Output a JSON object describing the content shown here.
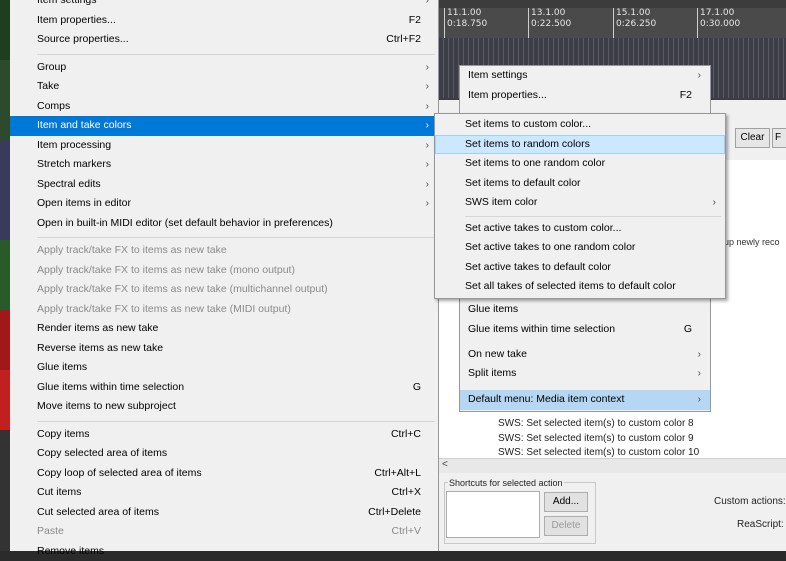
{
  "timeline": {
    "ticks": [
      {
        "bar": "11.1.00",
        "time": "0:18.750"
      },
      {
        "bar": "13.1.00",
        "time": "0:22.500"
      },
      {
        "bar": "15.1.00",
        "time": "0:26.250"
      },
      {
        "bar": "17.1.00",
        "time": "0:30.000"
      }
    ]
  },
  "main_menu": {
    "items": [
      {
        "label": "Item settings",
        "shortcut": "",
        "submenu": true,
        "disabled": false
      },
      {
        "label": "Item properties...",
        "shortcut": "F2",
        "submenu": false,
        "disabled": false
      },
      {
        "label": "Source properties...",
        "shortcut": "Ctrl+F2",
        "submenu": false,
        "disabled": false
      },
      {
        "sep": true
      },
      {
        "label": "Group",
        "shortcut": "",
        "submenu": true,
        "disabled": false
      },
      {
        "label": "Take",
        "shortcut": "",
        "submenu": true,
        "disabled": false
      },
      {
        "label": "Comps",
        "shortcut": "",
        "submenu": true,
        "disabled": false
      },
      {
        "label": "Item and take colors",
        "shortcut": "",
        "submenu": true,
        "disabled": false,
        "highlight": true
      },
      {
        "label": "Item processing",
        "shortcut": "",
        "submenu": true,
        "disabled": false
      },
      {
        "label": "Stretch markers",
        "shortcut": "",
        "submenu": true,
        "disabled": false
      },
      {
        "label": "Spectral edits",
        "shortcut": "",
        "submenu": true,
        "disabled": false
      },
      {
        "label": "Open items in editor",
        "shortcut": "",
        "submenu": true,
        "disabled": false
      },
      {
        "label": "Open in built-in MIDI editor (set default behavior in preferences)",
        "shortcut": "",
        "submenu": false,
        "disabled": false
      },
      {
        "sep": true
      },
      {
        "label": "Apply track/take FX to items as new take",
        "shortcut": "",
        "submenu": false,
        "disabled": true
      },
      {
        "label": "Apply track/take FX to items as new take (mono output)",
        "shortcut": "",
        "submenu": false,
        "disabled": true
      },
      {
        "label": "Apply track/take FX to items as new take (multichannel output)",
        "shortcut": "",
        "submenu": false,
        "disabled": true
      },
      {
        "label": "Apply track/take FX to items as new take (MIDI output)",
        "shortcut": "",
        "submenu": false,
        "disabled": true
      },
      {
        "label": "Render items as new take",
        "shortcut": "",
        "submenu": false,
        "disabled": false
      },
      {
        "label": "Reverse items as new take",
        "shortcut": "",
        "submenu": false,
        "disabled": false
      },
      {
        "label": "Glue items",
        "shortcut": "",
        "submenu": false,
        "disabled": false
      },
      {
        "label": "Glue items within time selection",
        "shortcut": "G",
        "submenu": false,
        "disabled": false
      },
      {
        "label": "Move items to new subproject",
        "shortcut": "",
        "submenu": false,
        "disabled": false
      },
      {
        "sep": true
      },
      {
        "label": "Copy items",
        "shortcut": "Ctrl+C",
        "submenu": false,
        "disabled": false
      },
      {
        "label": "Copy selected area of items",
        "shortcut": "",
        "submenu": false,
        "disabled": false
      },
      {
        "label": "Copy loop of selected area of items",
        "shortcut": "Ctrl+Alt+L",
        "submenu": false,
        "disabled": false
      },
      {
        "label": "Cut items",
        "shortcut": "Ctrl+X",
        "submenu": false,
        "disabled": false
      },
      {
        "label": "Cut selected area of items",
        "shortcut": "Ctrl+Delete",
        "submenu": false,
        "disabled": false
      },
      {
        "label": "Paste",
        "shortcut": "Ctrl+V",
        "submenu": false,
        "disabled": true
      },
      {
        "label": "Remove items",
        "shortcut": "",
        "submenu": false,
        "disabled": false
      }
    ]
  },
  "back_menu": {
    "items": [
      {
        "label": "Item settings",
        "shortcut": "",
        "submenu": true
      },
      {
        "label": "Item properties...",
        "shortcut": "F2",
        "submenu": false
      },
      {
        "label": "Glue items",
        "shortcut": "",
        "submenu": false
      },
      {
        "label": "Glue items within time selection",
        "shortcut": "G",
        "submenu": false
      },
      {
        "label": "On new take",
        "shortcut": "",
        "submenu": true
      },
      {
        "label": "Split items",
        "shortcut": "",
        "submenu": true
      },
      {
        "label": "Default menu: Media item context",
        "shortcut": "",
        "submenu": true,
        "highlight": true
      }
    ]
  },
  "color_menu": {
    "items": [
      {
        "label": "Set items to custom color...",
        "submenu": false
      },
      {
        "label": "Set items to random colors",
        "submenu": false,
        "highlight": true
      },
      {
        "label": "Set items to one random color",
        "submenu": false
      },
      {
        "label": "Set items to default color",
        "submenu": false
      },
      {
        "label": "SWS item color",
        "submenu": true
      },
      {
        "sep": true
      },
      {
        "label": "Set active takes to custom color...",
        "submenu": false
      },
      {
        "label": "Set active takes to one random color",
        "submenu": false
      },
      {
        "label": "Set active takes to default color",
        "submenu": false
      },
      {
        "label": "Set all takes of selected items to default color",
        "submenu": false
      }
    ]
  },
  "actions_window": {
    "clear_label": "Clear",
    "f_label": "F",
    "partial_text": "up newly reco",
    "rows": [
      "SWS: Set selected item(s) to custom color 8",
      "SWS: Set selected item(s) to custom color 9",
      "SWS: Set selected item(s) to custom color 10"
    ],
    "shortcuts_group_label": "Shortcuts for selected action",
    "add_label": "Add...",
    "delete_label": "Delete",
    "custom_actions_label": "Custom actions:",
    "reascript_label": "ReaScript:"
  },
  "colors": {
    "highlight": "#0078d7",
    "hover": "#cce8ff"
  }
}
